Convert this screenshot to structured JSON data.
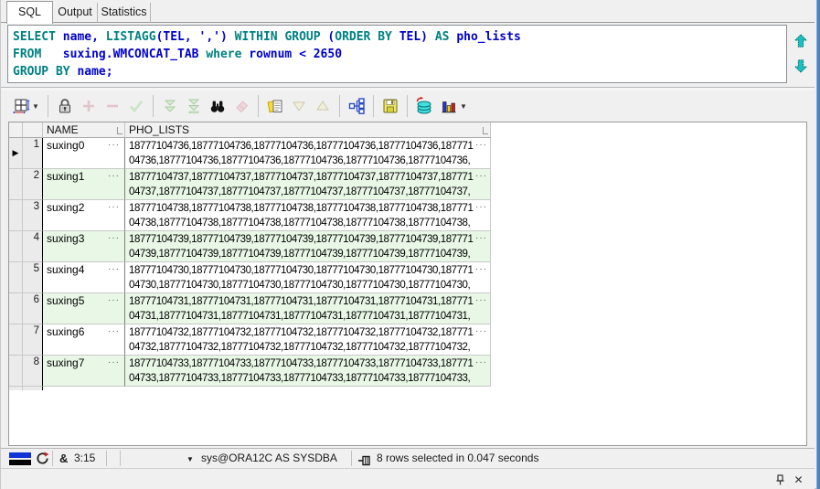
{
  "tabs": [
    {
      "label": "SQL",
      "active": true
    },
    {
      "label": "Output",
      "active": false
    },
    {
      "label": "Statistics",
      "active": false
    }
  ],
  "editor": {
    "lines": [
      [
        [
          "SELECT",
          "k"
        ],
        [
          " name, ",
          "n"
        ],
        [
          "LISTAGG",
          "k"
        ],
        [
          "(TEL, ',')",
          "n"
        ],
        [
          " WITHIN GROUP ",
          "k"
        ],
        [
          "(",
          "n"
        ],
        [
          "ORDER BY",
          "k"
        ],
        [
          " TEL)",
          "n"
        ],
        [
          " AS ",
          "k"
        ],
        [
          "pho_lists",
          "n"
        ]
      ],
      [
        [
          "FROM",
          "k"
        ],
        [
          "   suxing.WMCONCAT_TAB ",
          "n"
        ],
        [
          "where",
          "k"
        ],
        [
          " rownum < 2650",
          "n"
        ]
      ],
      [
        [
          "GROUP BY",
          "k"
        ],
        [
          " name;",
          "n"
        ]
      ]
    ],
    "keyword_color": "#008080",
    "identifier_color": "#0000cd"
  },
  "toolbar": {
    "icons": [
      "grid-options",
      "lock",
      "add-row",
      "delete-row",
      "post-edit",
      "fetch-next-page",
      "fetch-last-page",
      "find",
      "erase",
      "export-data",
      "sort-descending",
      "sort-ascending",
      "manage-grid",
      "save",
      "refresh-data",
      "chart"
    ]
  },
  "grid": {
    "columns": [
      "NAME",
      "PHO_LISTS"
    ],
    "rows": [
      {
        "num": "1",
        "name": "suxing0",
        "current": true,
        "pho_line1": "18777104736,18777104736,18777104736,18777104736,18777104736,187771",
        "pho_line2": "04736,18777104736,18777104736,18777104736,18777104736,18777104736,"
      },
      {
        "num": "2",
        "name": "suxing1",
        "current": false,
        "pho_line1": "18777104737,18777104737,18777104737,18777104737,18777104737,187771",
        "pho_line2": "04737,18777104737,18777104737,18777104737,18777104737,18777104737,"
      },
      {
        "num": "3",
        "name": "suxing2",
        "current": false,
        "pho_line1": "18777104738,18777104738,18777104738,18777104738,18777104738,187771",
        "pho_line2": "04738,18777104738,18777104738,18777104738,18777104738,18777104738,"
      },
      {
        "num": "4",
        "name": "suxing3",
        "current": false,
        "pho_line1": "18777104739,18777104739,18777104739,18777104739,18777104739,187771",
        "pho_line2": "04739,18777104739,18777104739,18777104739,18777104739,18777104739,"
      },
      {
        "num": "5",
        "name": "suxing4",
        "current": false,
        "pho_line1": "18777104730,18777104730,18777104730,18777104730,18777104730,187771",
        "pho_line2": "04730,18777104730,18777104730,18777104730,18777104730,18777104730,"
      },
      {
        "num": "6",
        "name": "suxing5",
        "current": false,
        "pho_line1": "18777104731,18777104731,18777104731,18777104731,18777104731,187771",
        "pho_line2": "04731,18777104731,18777104731,18777104731,18777104731,18777104731,"
      },
      {
        "num": "7",
        "name": "suxing6",
        "current": false,
        "pho_line1": "18777104732,18777104732,18777104732,18777104732,18777104732,187771",
        "pho_line2": "04732,18777104732,18777104732,18777104732,18777104732,18777104732,"
      },
      {
        "num": "8",
        "name": "suxing7",
        "current": false,
        "pho_line1": "18777104733,18777104733,18777104733,18777104733,18777104733,187771",
        "pho_line2": "04733,18777104733,18777104733,18777104733,18777104733,18777104733,"
      }
    ]
  },
  "statusbar": {
    "time": "3:15",
    "connection": "sys@ORA12C AS SYSDBA",
    "result": "8 rows selected in 0.047 seconds"
  },
  "colors": {
    "alt_row": "#e8f7e6",
    "keyword": "#008080",
    "identifier": "#0000cd",
    "accent_border": "#4a84c4"
  }
}
